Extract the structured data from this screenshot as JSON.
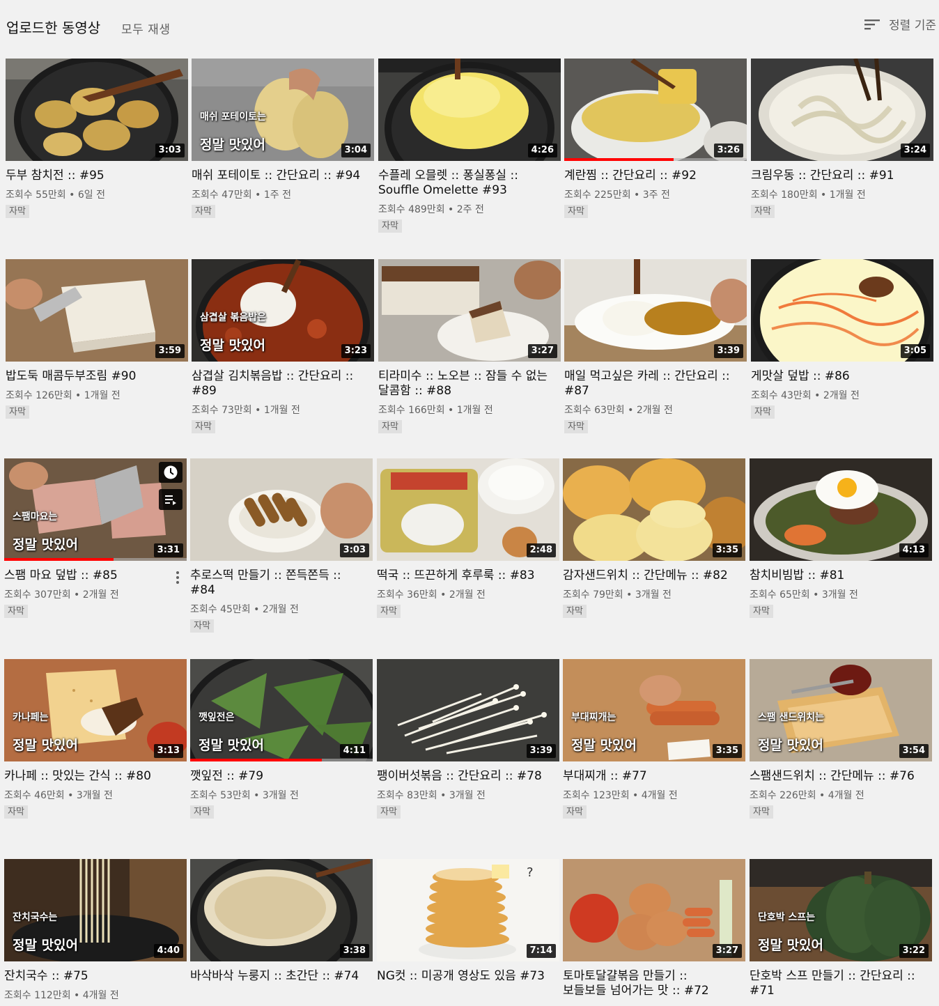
{
  "header": {
    "title": "업로드한 동영상",
    "play_all": "모두 재생",
    "sort_label": "정렬 기준",
    "sort_icon": "sort-icon"
  },
  "colors": {
    "progress": "#ff0000",
    "background": "#f1f1f1",
    "meta_text": "#606060"
  },
  "videos": [
    {
      "title": "두부 참치전 :: #95",
      "views": "조회수 55만회",
      "age": "6일 전",
      "badge": "자막",
      "duration": "3:03",
      "caption1": "",
      "caption2": "",
      "thumb": "pan-pancakes"
    },
    {
      "title": "매쉬 포테이토 :: 간단요리 :: #94",
      "views": "조회수 47만회",
      "age": "1주 전",
      "badge": "자막",
      "duration": "3:04",
      "caption1": "매쉬 포테이토는",
      "caption2": "정말 맛있어",
      "thumb": "potatoes"
    },
    {
      "title": "수플레 오믈렛 :: 퐁실퐁실 :: Souffle Omelette #93",
      "views": "조회수 489만회",
      "age": "2주 전",
      "badge": "자막",
      "duration": "4:26",
      "caption1": "",
      "caption2": "",
      "thumb": "souffle"
    },
    {
      "title": "계란찜 :: 간단요리 :: #92",
      "views": "조회수 225만회",
      "age": "3주 전",
      "badge": "자막",
      "duration": "3:26",
      "caption1": "",
      "caption2": "",
      "thumb": "egg-bowl",
      "progress": 0.6
    },
    {
      "title": "크림우동 :: 간단요리 :: #91",
      "views": "조회수 180만회",
      "age": "1개월 전",
      "badge": "자막",
      "duration": "3:24",
      "caption1": "",
      "caption2": "",
      "thumb": "cream-udon"
    },
    {
      "title": "밥도둑 매콤두부조림 #90",
      "views": "조회수 126만회",
      "age": "1개월 전",
      "badge": "자막",
      "duration": "3:59",
      "caption1": "",
      "caption2": "",
      "thumb": "tofu"
    },
    {
      "title": "삼겹살 김치볶음밥 :: 간단요리 :: #89",
      "views": "조회수 73만회",
      "age": "1개월 전",
      "badge": "자막",
      "duration": "3:23",
      "caption1": "삼겹살 볶음밥은",
      "caption2": "정말 맛있어",
      "thumb": "fried-rice"
    },
    {
      "title": "티라미수 :: 노오븐 :: 잠들 수 없는 달콤함 :: #88",
      "views": "조회수 166만회",
      "age": "1개월 전",
      "badge": "자막",
      "duration": "3:27",
      "caption1": "",
      "caption2": "",
      "thumb": "tiramisu"
    },
    {
      "title": "매일 먹고싶은 카레 :: 간단요리 :: #87",
      "views": "조회수 63만회",
      "age": "2개월 전",
      "badge": "자막",
      "duration": "3:39",
      "caption1": "",
      "caption2": "",
      "thumb": "curry"
    },
    {
      "title": "게맛살 덮밥 :: #86",
      "views": "조회수 43만회",
      "age": "2개월 전",
      "badge": "자막",
      "duration": "3:05",
      "caption1": "",
      "caption2": "",
      "thumb": "crab-pan"
    },
    {
      "title": "스팸 마요 덮밥 :: #85",
      "views": "조회수 307만회",
      "age": "2개월 전",
      "badge": "자막",
      "duration": "3:31",
      "caption1": "스팸마요는",
      "caption2": "정말 맛있어",
      "thumb": "spam",
      "progress": 0.6,
      "hovered": true
    },
    {
      "title": "추로스떡 만들기 :: 쫀득쫀득 :: #84",
      "views": "조회수 45만회",
      "age": "2개월 전",
      "badge": "자막",
      "duration": "3:03",
      "caption1": "",
      "caption2": "",
      "thumb": "churros"
    },
    {
      "title": "떡국 :: 뜨끈하게 후루룩 :: #83",
      "views": "조회수 36만회",
      "age": "2개월 전",
      "badge": "자막",
      "duration": "2:48",
      "caption1": "",
      "caption2": "",
      "thumb": "tteokguk"
    },
    {
      "title": "감자샌드위치 :: 간단메뉴 :: #82",
      "views": "조회수 79만회",
      "age": "3개월 전",
      "badge": "자막",
      "duration": "3:35",
      "caption1": "",
      "caption2": "",
      "thumb": "buns"
    },
    {
      "title": "참치비빔밥 :: #81",
      "views": "조회수 65만회",
      "age": "3개월 전",
      "badge": "자막",
      "duration": "4:13",
      "caption1": "",
      "caption2": "",
      "thumb": "bibimbap"
    },
    {
      "title": "카나페 :: 맛있는 간식 :: #80",
      "views": "조회수 46만회",
      "age": "3개월 전",
      "badge": "자막",
      "duration": "3:13",
      "caption1": "카나페는",
      "caption2": "정말 맛있어",
      "thumb": "canape"
    },
    {
      "title": "깻잎전 :: #79",
      "views": "조회수 53만회",
      "age": "3개월 전",
      "badge": "자막",
      "duration": "4:11",
      "caption1": "깻잎전은",
      "caption2": "정말 맛있어",
      "thumb": "perilla",
      "progress": 0.72
    },
    {
      "title": "팽이버섯볶음 :: 간단요리 :: #78",
      "views": "조회수 83만회",
      "age": "3개월 전",
      "badge": "자막",
      "duration": "3:39",
      "caption1": "",
      "caption2": "",
      "thumb": "enoki"
    },
    {
      "title": "부대찌개 :: #77",
      "views": "조회수 123만회",
      "age": "4개월 전",
      "badge": "자막",
      "duration": "3:35",
      "caption1": "부대찌개는",
      "caption2": "정말 맛있어",
      "thumb": "sausage-board"
    },
    {
      "title": "스팸샌드위치 :: 간단메뉴 :: #76",
      "views": "조회수 226만회",
      "age": "4개월 전",
      "badge": "자막",
      "duration": "3:54",
      "caption1": "스팸 샌드위치는",
      "caption2": "정말 맛있어",
      "thumb": "toast"
    },
    {
      "title": "잔치국수 :: #75",
      "views": "조회수 112만회",
      "age": "4개월 전",
      "badge": "",
      "duration": "4:40",
      "caption1": "잔치국수는",
      "caption2": "정말 맛있어",
      "thumb": "noodles"
    },
    {
      "title": "바삭바삭 누룽지 :: 초간단 :: #74",
      "views": "",
      "age": "",
      "badge": "",
      "duration": "3:38",
      "caption1": "",
      "caption2": "",
      "thumb": "nurungji"
    },
    {
      "title": "NG컷 :: 미공개 영상도 있음 #73",
      "views": "",
      "age": "",
      "badge": "",
      "duration": "7:14",
      "caption1": "",
      "caption2": "",
      "thumb": "pancakes-stack"
    },
    {
      "title": "토마토달걀볶음 만들기 :: 보들보들 넘어가는 맛 :: #72",
      "views": "",
      "age": "",
      "badge": "",
      "duration": "3:27",
      "caption1": "",
      "caption2": "",
      "thumb": "tomato-eggs"
    },
    {
      "title": "단호박 스프 만들기 :: 간단요리 :: #71",
      "views": "",
      "age": "",
      "badge": "",
      "duration": "3:22",
      "caption1": "단호박 스프는",
      "caption2": "정말 맛있어",
      "thumb": "pumpkin"
    }
  ]
}
